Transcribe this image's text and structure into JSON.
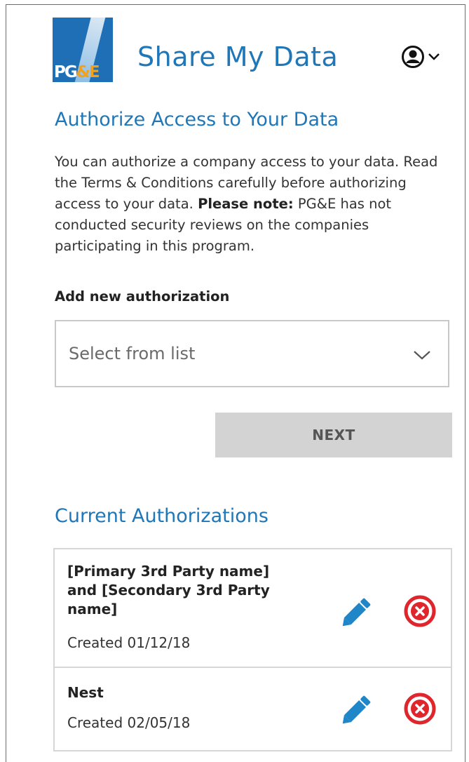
{
  "header": {
    "logo_text": "PG&E",
    "app_title": "Share My Data",
    "account_icon": "user-circle-icon",
    "account_chevron_icon": "chevron-down-icon"
  },
  "authorize": {
    "title": "Authorize Access to Your Data",
    "intro_text": "You can authorize a company access to your data. Read the Terms & Conditions carefully before authorizing access to your data.",
    "note_label": "Please note:",
    "note_text": "PG&E has not conducted security reviews on the companies participating in this program."
  },
  "new_authorization": {
    "label": "Add new authorization",
    "select_placeholder": "Select from list",
    "next_label": "NEXT"
  },
  "current": {
    "title": "Current Authorizations",
    "items": [
      {
        "name_line1": "[Primary 3rd Party name]",
        "name_line2": "and [Secondary 3rd Party",
        "name_line3": "name]",
        "created": "Created 01/12/18"
      },
      {
        "name_line1": "Nest",
        "created": "Created 02/05/18"
      }
    ]
  },
  "colors": {
    "brand_blue": "#1f77b8",
    "remove_red": "#e0262d",
    "button_gray": "#d3d3d3"
  }
}
